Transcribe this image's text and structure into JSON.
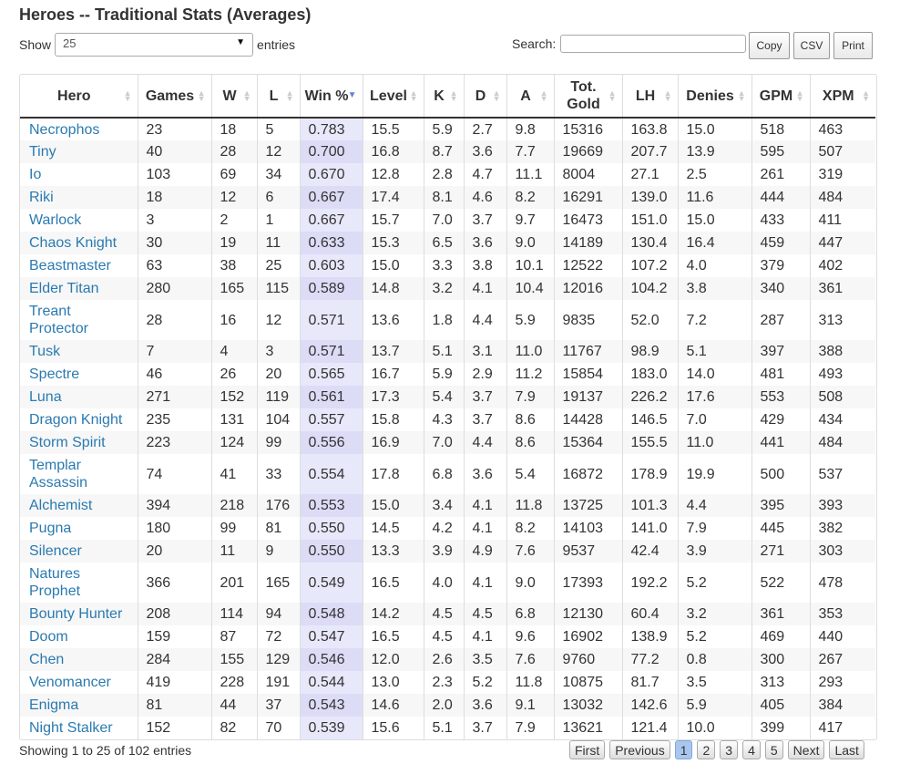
{
  "title": "Heroes -- Traditional Stats (Averages)",
  "length": {
    "show_label": "Show",
    "value": "25",
    "entries_label": "entries"
  },
  "search": {
    "label": "Search:",
    "value": ""
  },
  "buttons": {
    "copy": "Copy",
    "csv": "CSV",
    "print": "Print"
  },
  "columns": [
    "Hero",
    "Games",
    "W",
    "L",
    "Win %",
    "Level",
    "K",
    "D",
    "A",
    "Tot. Gold",
    "LH",
    "Denies",
    "GPM",
    "XPM"
  ],
  "rows": [
    [
      "Necrophos",
      "23",
      "18",
      "5",
      "0.783",
      "15.5",
      "5.9",
      "2.7",
      "9.8",
      "15316",
      "163.8",
      "15.0",
      "518",
      "463"
    ],
    [
      "Tiny",
      "40",
      "28",
      "12",
      "0.700",
      "16.8",
      "8.7",
      "3.6",
      "7.7",
      "19669",
      "207.7",
      "13.9",
      "595",
      "507"
    ],
    [
      "Io",
      "103",
      "69",
      "34",
      "0.670",
      "12.8",
      "2.8",
      "4.7",
      "11.1",
      "8004",
      "27.1",
      "2.5",
      "261",
      "319"
    ],
    [
      "Riki",
      "18",
      "12",
      "6",
      "0.667",
      "17.4",
      "8.1",
      "4.6",
      "8.2",
      "16291",
      "139.0",
      "11.6",
      "444",
      "484"
    ],
    [
      "Warlock",
      "3",
      "2",
      "1",
      "0.667",
      "15.7",
      "7.0",
      "3.7",
      "9.7",
      "16473",
      "151.0",
      "15.0",
      "433",
      "411"
    ],
    [
      "Chaos Knight",
      "30",
      "19",
      "11",
      "0.633",
      "15.3",
      "6.5",
      "3.6",
      "9.0",
      "14189",
      "130.4",
      "16.4",
      "459",
      "447"
    ],
    [
      "Beastmaster",
      "63",
      "38",
      "25",
      "0.603",
      "15.0",
      "3.3",
      "3.8",
      "10.1",
      "12522",
      "107.2",
      "4.0",
      "379",
      "402"
    ],
    [
      "Elder Titan",
      "280",
      "165",
      "115",
      "0.589",
      "14.8",
      "3.2",
      "4.1",
      "10.4",
      "12016",
      "104.2",
      "3.8",
      "340",
      "361"
    ],
    [
      "Treant Protector",
      "28",
      "16",
      "12",
      "0.571",
      "13.6",
      "1.8",
      "4.4",
      "5.9",
      "9835",
      "52.0",
      "7.2",
      "287",
      "313"
    ],
    [
      "Tusk",
      "7",
      "4",
      "3",
      "0.571",
      "13.7",
      "5.1",
      "3.1",
      "11.0",
      "11767",
      "98.9",
      "5.1",
      "397",
      "388"
    ],
    [
      "Spectre",
      "46",
      "26",
      "20",
      "0.565",
      "16.7",
      "5.9",
      "2.9",
      "11.2",
      "15854",
      "183.0",
      "14.0",
      "481",
      "493"
    ],
    [
      "Luna",
      "271",
      "152",
      "119",
      "0.561",
      "17.3",
      "5.4",
      "3.7",
      "7.9",
      "19137",
      "226.2",
      "17.6",
      "553",
      "508"
    ],
    [
      "Dragon Knight",
      "235",
      "131",
      "104",
      "0.557",
      "15.8",
      "4.3",
      "3.7",
      "8.6",
      "14428",
      "146.5",
      "7.0",
      "429",
      "434"
    ],
    [
      "Storm Spirit",
      "223",
      "124",
      "99",
      "0.556",
      "16.9",
      "7.0",
      "4.4",
      "8.6",
      "15364",
      "155.5",
      "11.0",
      "441",
      "484"
    ],
    [
      "Templar Assassin",
      "74",
      "41",
      "33",
      "0.554",
      "17.8",
      "6.8",
      "3.6",
      "5.4",
      "16872",
      "178.9",
      "19.9",
      "500",
      "537"
    ],
    [
      "Alchemist",
      "394",
      "218",
      "176",
      "0.553",
      "15.0",
      "3.4",
      "4.1",
      "11.8",
      "13725",
      "101.3",
      "4.4",
      "395",
      "393"
    ],
    [
      "Pugna",
      "180",
      "99",
      "81",
      "0.550",
      "14.5",
      "4.2",
      "4.1",
      "8.2",
      "14103",
      "141.0",
      "7.9",
      "445",
      "382"
    ],
    [
      "Silencer",
      "20",
      "11",
      "9",
      "0.550",
      "13.3",
      "3.9",
      "4.9",
      "7.6",
      "9537",
      "42.4",
      "3.9",
      "271",
      "303"
    ],
    [
      "Natures Prophet",
      "366",
      "201",
      "165",
      "0.549",
      "16.5",
      "4.0",
      "4.1",
      "9.0",
      "17393",
      "192.2",
      "5.2",
      "522",
      "478"
    ],
    [
      "Bounty Hunter",
      "208",
      "114",
      "94",
      "0.548",
      "14.2",
      "4.5",
      "4.5",
      "6.8",
      "12130",
      "60.4",
      "3.2",
      "361",
      "353"
    ],
    [
      "Doom",
      "159",
      "87",
      "72",
      "0.547",
      "16.5",
      "4.5",
      "4.1",
      "9.6",
      "16902",
      "138.9",
      "5.2",
      "469",
      "440"
    ],
    [
      "Chen",
      "284",
      "155",
      "129",
      "0.546",
      "12.0",
      "2.6",
      "3.5",
      "7.6",
      "9760",
      "77.2",
      "0.8",
      "300",
      "267"
    ],
    [
      "Venomancer",
      "419",
      "228",
      "191",
      "0.544",
      "13.0",
      "2.3",
      "5.2",
      "11.8",
      "10875",
      "81.7",
      "3.5",
      "313",
      "293"
    ],
    [
      "Enigma",
      "81",
      "44",
      "37",
      "0.543",
      "14.6",
      "2.0",
      "3.6",
      "9.1",
      "13032",
      "142.6",
      "5.9",
      "405",
      "384"
    ],
    [
      "Night Stalker",
      "152",
      "82",
      "70",
      "0.539",
      "15.6",
      "5.1",
      "3.7",
      "7.9",
      "13621",
      "121.4",
      "10.0",
      "399",
      "417"
    ]
  ],
  "info": "Showing 1 to 25 of 102 entries",
  "pagination": {
    "first": "First",
    "previous": "Previous",
    "pages": [
      "1",
      "2",
      "3",
      "4",
      "5"
    ],
    "current": "1",
    "next": "Next",
    "last": "Last"
  },
  "colors": {
    "link": "#2a7ab0",
    "sorted_col": "#e8e8fb",
    "current_page": "#a9c7ee"
  }
}
